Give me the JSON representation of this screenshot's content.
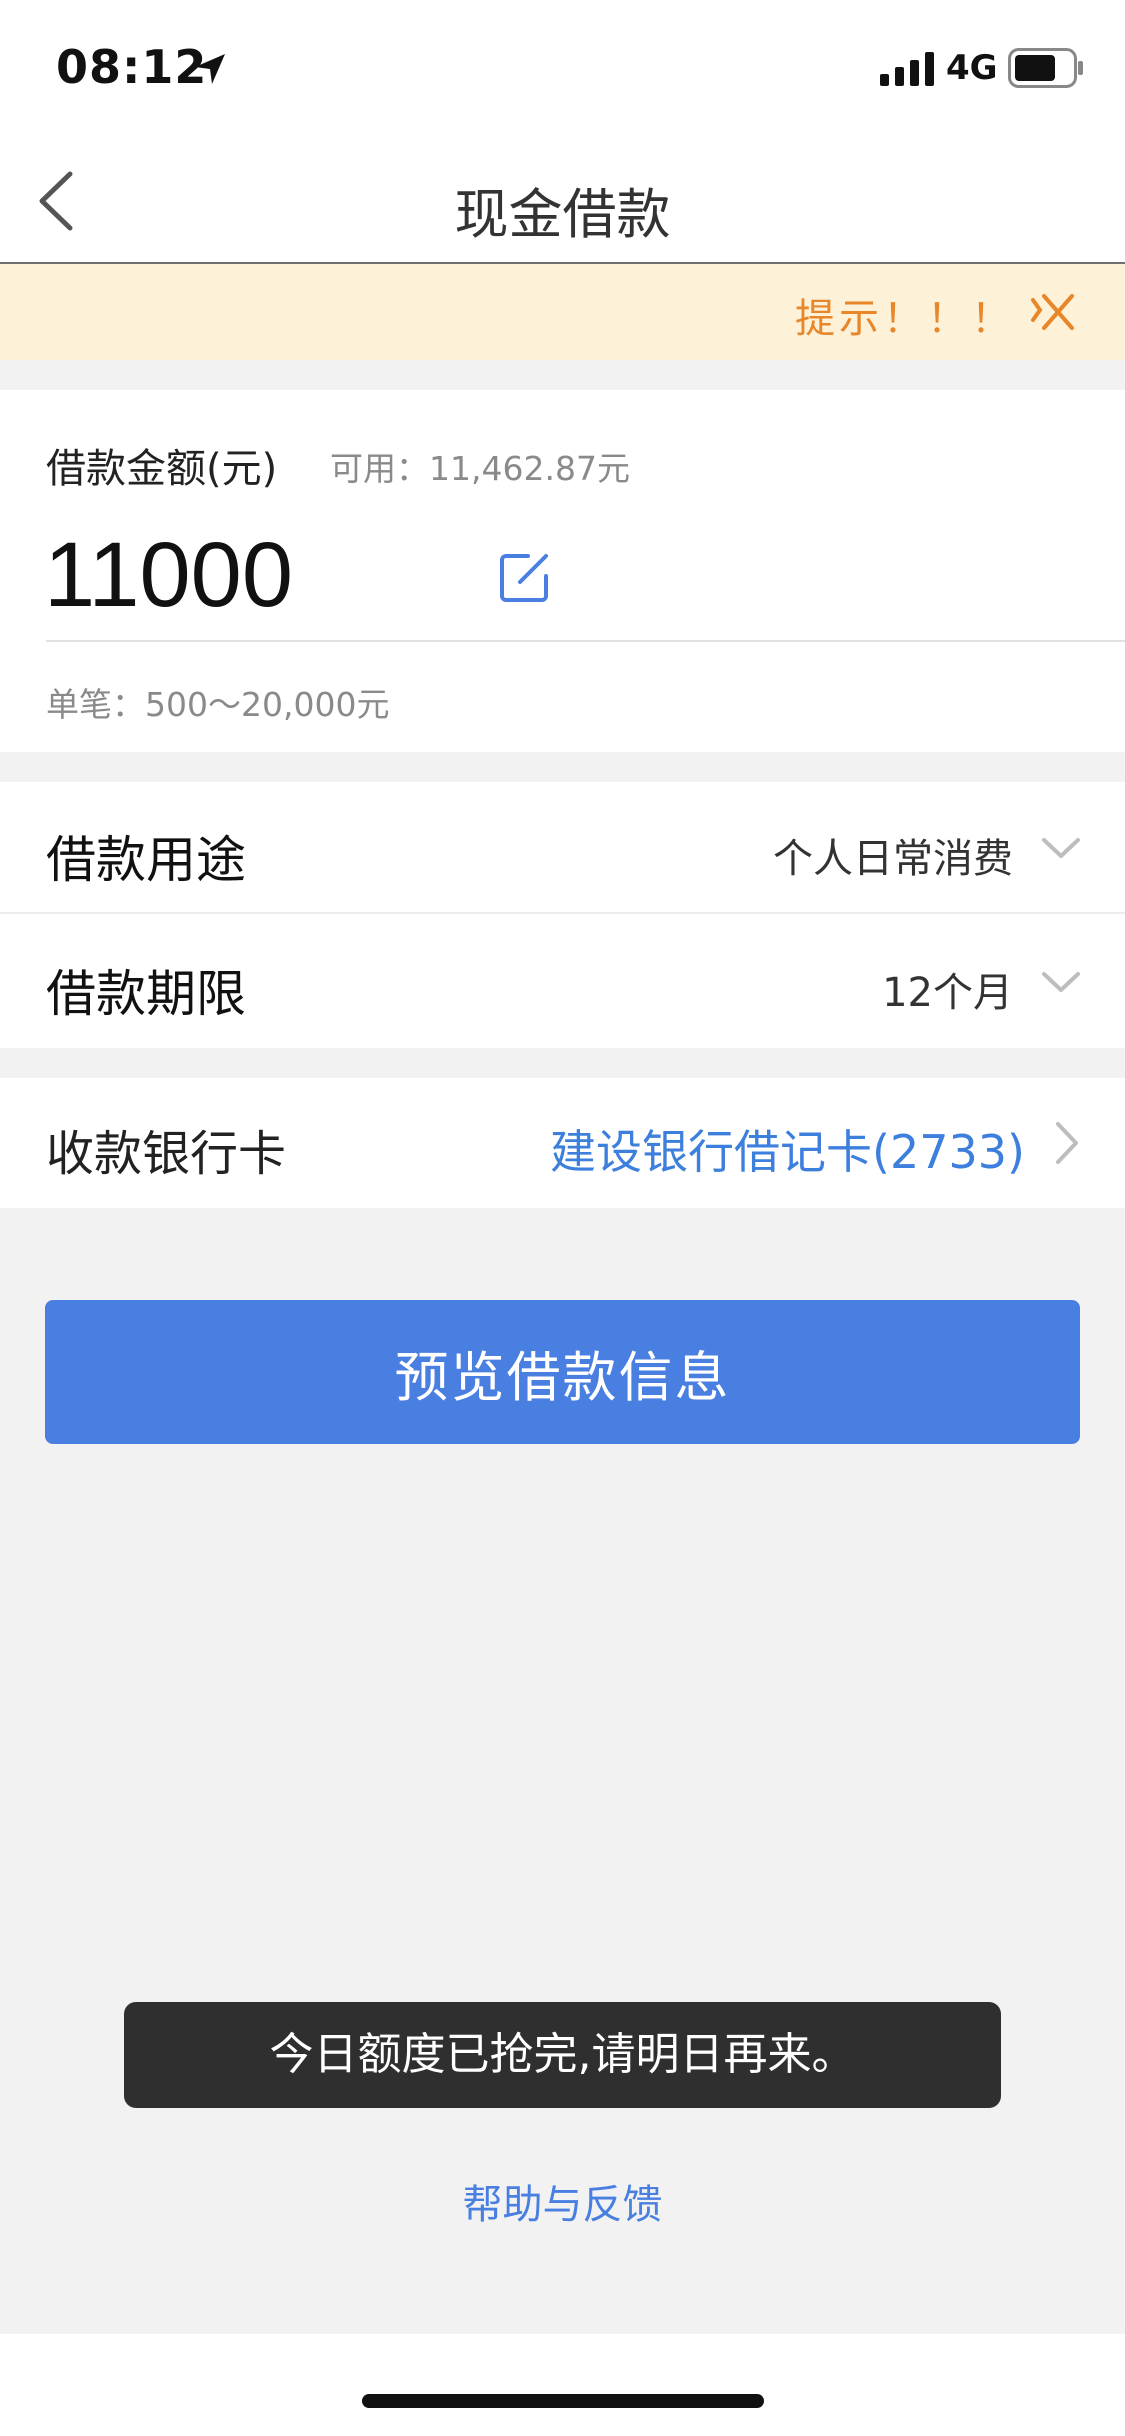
{
  "status_bar": {
    "time": "08:12",
    "network": "4G",
    "icons": [
      "location-arrow-icon",
      "signal-bars-icon",
      "battery-icon"
    ]
  },
  "nav": {
    "title": "现金借款",
    "back_icon": "chevron-left-icon"
  },
  "notice": {
    "text": "提示！！！",
    "close_icon": "close-icon",
    "color": "#e8862a"
  },
  "amount": {
    "label": "借款金额(元)",
    "available": "可用：11,462.87元",
    "value": "11000",
    "edit_icon": "edit-icon",
    "range": "单笔：500～20,000元"
  },
  "options": [
    {
      "label": "借款用途",
      "value": "个人日常消费"
    },
    {
      "label": "借款期限",
      "value": "12个月"
    }
  ],
  "bank": {
    "label": "收款银行卡",
    "value": "建设银行借记卡(2733)",
    "color": "#3d7fdd"
  },
  "primary_button": {
    "label": "预览借款信息",
    "color": "#4a7fe2"
  },
  "toast": {
    "text": "今日额度已抢完,请明日再来。"
  },
  "help": {
    "label": "帮助与反馈"
  }
}
